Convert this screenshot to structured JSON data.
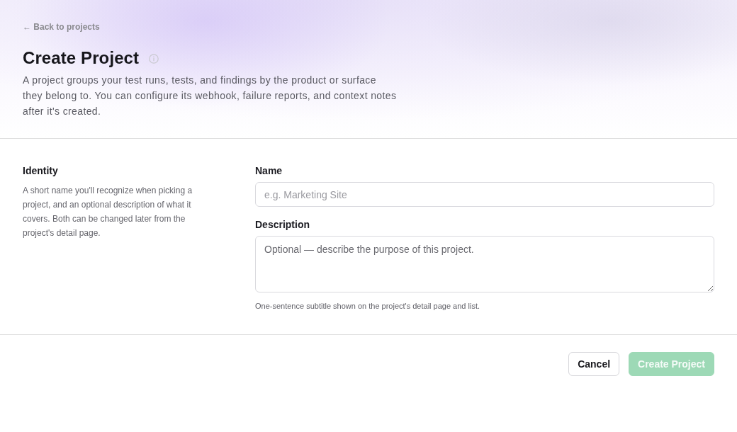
{
  "back_link": {
    "label": "← Back to projects"
  },
  "header": {
    "title": "Create Project",
    "description": "A project groups your test runs, tests, and findings by the product or surface they belong to. You can configure its webhook, failure reports, and context notes after it's created."
  },
  "section": {
    "title": "Identity",
    "description": "A short name you'll recognize when picking a project, and an optional description of what it covers. Both can be changed later from the project's detail page.",
    "fields": [
      {
        "kind": "input",
        "label": "Name",
        "placeholder": "e.g. Marketing Site"
      },
      {
        "kind": "textarea",
        "label": "Description",
        "placeholder": "Optional — describe the purpose of this project.",
        "hint": "One-sentence subtitle shown on the project's detail page and list."
      }
    ]
  },
  "actions": [
    {
      "kind": "secondary",
      "label": "Cancel",
      "disabled": false
    },
    {
      "kind": "primary",
      "label": "Create Project",
      "disabled": true
    }
  ]
}
